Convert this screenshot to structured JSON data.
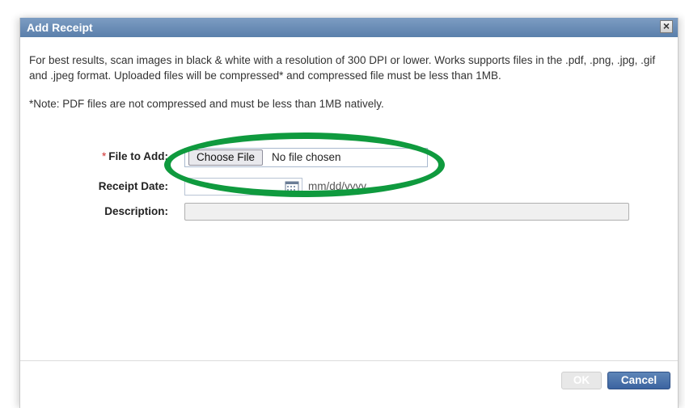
{
  "dialog": {
    "title": "Add Receipt",
    "close_label": "×"
  },
  "content": {
    "info_text": "For best results, scan images in black & white with a resolution of 300 DPI or lower. Works supports files in the .pdf, .png, .jpg, .gif and .jpeg format. Uploaded files will be compressed* and compressed file must be less than 1MB.",
    "note_text": "*Note: PDF files are not compressed and must be less than 1MB natively."
  },
  "form": {
    "required_mark": "*",
    "file_label": "File to Add:",
    "choose_file_button": "Choose File",
    "file_status": "No file chosen",
    "receipt_date_label": "Receipt Date:",
    "receipt_date_value": "",
    "date_format_hint": "mm/dd/yyyy",
    "description_label": "Description:",
    "description_value": ""
  },
  "footer": {
    "ok_label": "OK",
    "cancel_label": "Cancel"
  },
  "icons": {
    "close": "close-icon",
    "calendar": "calendar-icon"
  },
  "colors": {
    "titlebar": "#5a7fab",
    "highlight": "#0f9a3e",
    "cancel_button": "#3b63a0"
  }
}
